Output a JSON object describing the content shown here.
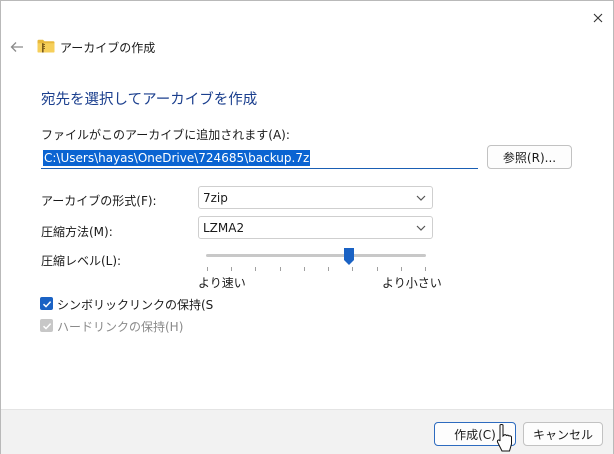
{
  "window": {
    "title": "アーカイブの作成",
    "icons": {
      "close": "close-icon",
      "back": "arrow-left-icon",
      "folder": "folder-zip-icon"
    }
  },
  "heading": "宛先を選択してアーカイブを作成",
  "destination": {
    "label": "ファイルがこのアーカイブに追加されます(A):",
    "value": "C:\\Users\\hayas\\OneDrive\\724685\\backup.7z",
    "browse_label": "参照(R)..."
  },
  "format": {
    "label": "アーカイブの形式(F):",
    "selected": "7zip"
  },
  "method": {
    "label": "圧縮方法(M):",
    "selected": "LZMA2"
  },
  "level": {
    "label": "圧縮レベル(L):",
    "min_label": "より速い",
    "max_label": "より小さい",
    "tick_count": 10,
    "value_fraction": 0.65
  },
  "options": {
    "symlinks_label": "シンボリックリンクの保持(S",
    "symlinks_checked": true,
    "hardlinks_label": "ハードリンクの保持(H)",
    "hardlinks_checked": true,
    "hardlinks_disabled": true
  },
  "buttons": {
    "create": "作成(C)",
    "cancel": "キャンセル"
  },
  "colors": {
    "accent": "#1a62c4",
    "heading": "#1b3f8e",
    "selection": "#0a64d2"
  }
}
